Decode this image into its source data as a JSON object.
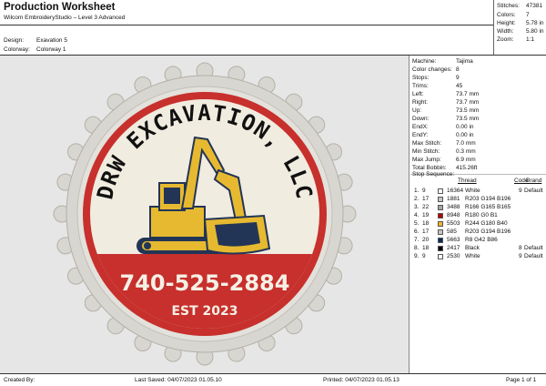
{
  "header": {
    "title": "Production Worksheet",
    "software": "Wilcom EmbroideryStudio – Level 3 Advanced",
    "design_label": "Design:",
    "design_value": "Exavation 5",
    "colorway_label": "Colorway:",
    "colorway_value": "Colorway 1"
  },
  "stats": [
    {
      "key": "Stitches:",
      "value": "47381"
    },
    {
      "key": "Colors:",
      "value": "7"
    },
    {
      "key": "Height:",
      "value": "5.78 in"
    },
    {
      "key": "Width:",
      "value": "5.80 in"
    },
    {
      "key": "Zoom:",
      "value": "1:1"
    }
  ],
  "design": {
    "company": "DRW EXCAVATION, LLC",
    "phone": "740-525-2884",
    "est": "EST 2023",
    "colors": {
      "red": "#c7302c",
      "cream": "#f1ece0",
      "rim": "#d4d2cc",
      "yellow": "#e6b930",
      "navy": "#233556"
    }
  },
  "details": [
    {
      "key": "Machine:",
      "value": "Tajima"
    },
    {
      "key": "Color changes:",
      "value": "8"
    },
    {
      "key": "Stops:",
      "value": "9"
    },
    {
      "key": "Trims:",
      "value": "45"
    },
    {
      "key": "Left:",
      "value": "73.7 mm"
    },
    {
      "key": "Right:",
      "value": "73.7 mm"
    },
    {
      "key": "Up:",
      "value": "73.5 mm"
    },
    {
      "key": "Down:",
      "value": "73.5 mm"
    },
    {
      "key": "EndX:",
      "value": "0.00 in"
    },
    {
      "key": "EndY:",
      "value": "0.00 in"
    },
    {
      "key": "Max Stitch:",
      "value": "7.0 mm"
    },
    {
      "key": "Min Stitch:",
      "value": "0.3 mm"
    },
    {
      "key": "Max Jump:",
      "value": "6.9 mm"
    },
    {
      "key": "Total Bobbin:",
      "value": "415.26ft"
    }
  ],
  "stop_sequence": {
    "title": "Stop Sequence:",
    "headers": {
      "thread": "Thread",
      "code": "Code",
      "brand": "Brand"
    },
    "rows": [
      {
        "num": "1.",
        "stop": "9",
        "color": "#ffffff",
        "thread": "16364",
        "name": "White",
        "code": "9",
        "brand": "Default"
      },
      {
        "num": "2.",
        "stop": "17",
        "color": "#cbc2c4",
        "thread": "1881",
        "name": "R203 G194 B196",
        "code": "",
        "brand": ""
      },
      {
        "num": "3.",
        "stop": "22",
        "color": "#a6a5a5",
        "thread": "3488",
        "name": "R166 G165 B165",
        "code": "",
        "brand": ""
      },
      {
        "num": "4.",
        "stop": "19",
        "color": "#b40001",
        "thread": "8948",
        "name": "R180 G0 B1",
        "code": "",
        "brand": ""
      },
      {
        "num": "5.",
        "stop": "18",
        "color": "#f4b428",
        "thread": "5503",
        "name": "R244 G180 B40",
        "code": "",
        "brand": ""
      },
      {
        "num": "6.",
        "stop": "17",
        "color": "#cbc2c4",
        "thread": "585",
        "name": "R203 G194 B196",
        "code": "",
        "brand": ""
      },
      {
        "num": "7.",
        "stop": "20",
        "color": "#082a56",
        "thread": "5663",
        "name": "R8 G42 B86",
        "code": "",
        "brand": ""
      },
      {
        "num": "8.",
        "stop": "18",
        "color": "#000000",
        "thread": "2417",
        "name": "Black",
        "code": "8",
        "brand": "Default"
      },
      {
        "num": "9.",
        "stop": "9",
        "color": "#ffffff",
        "thread": "2530",
        "name": "White",
        "code": "9",
        "brand": "Default"
      }
    ]
  },
  "footer": {
    "created_by": "Created By:",
    "last_saved": "Last Saved: 04/07/2023 01.05.10",
    "printed": "Printed: 04/07/2023 01.05.13",
    "page": "Page 1 of 1"
  }
}
